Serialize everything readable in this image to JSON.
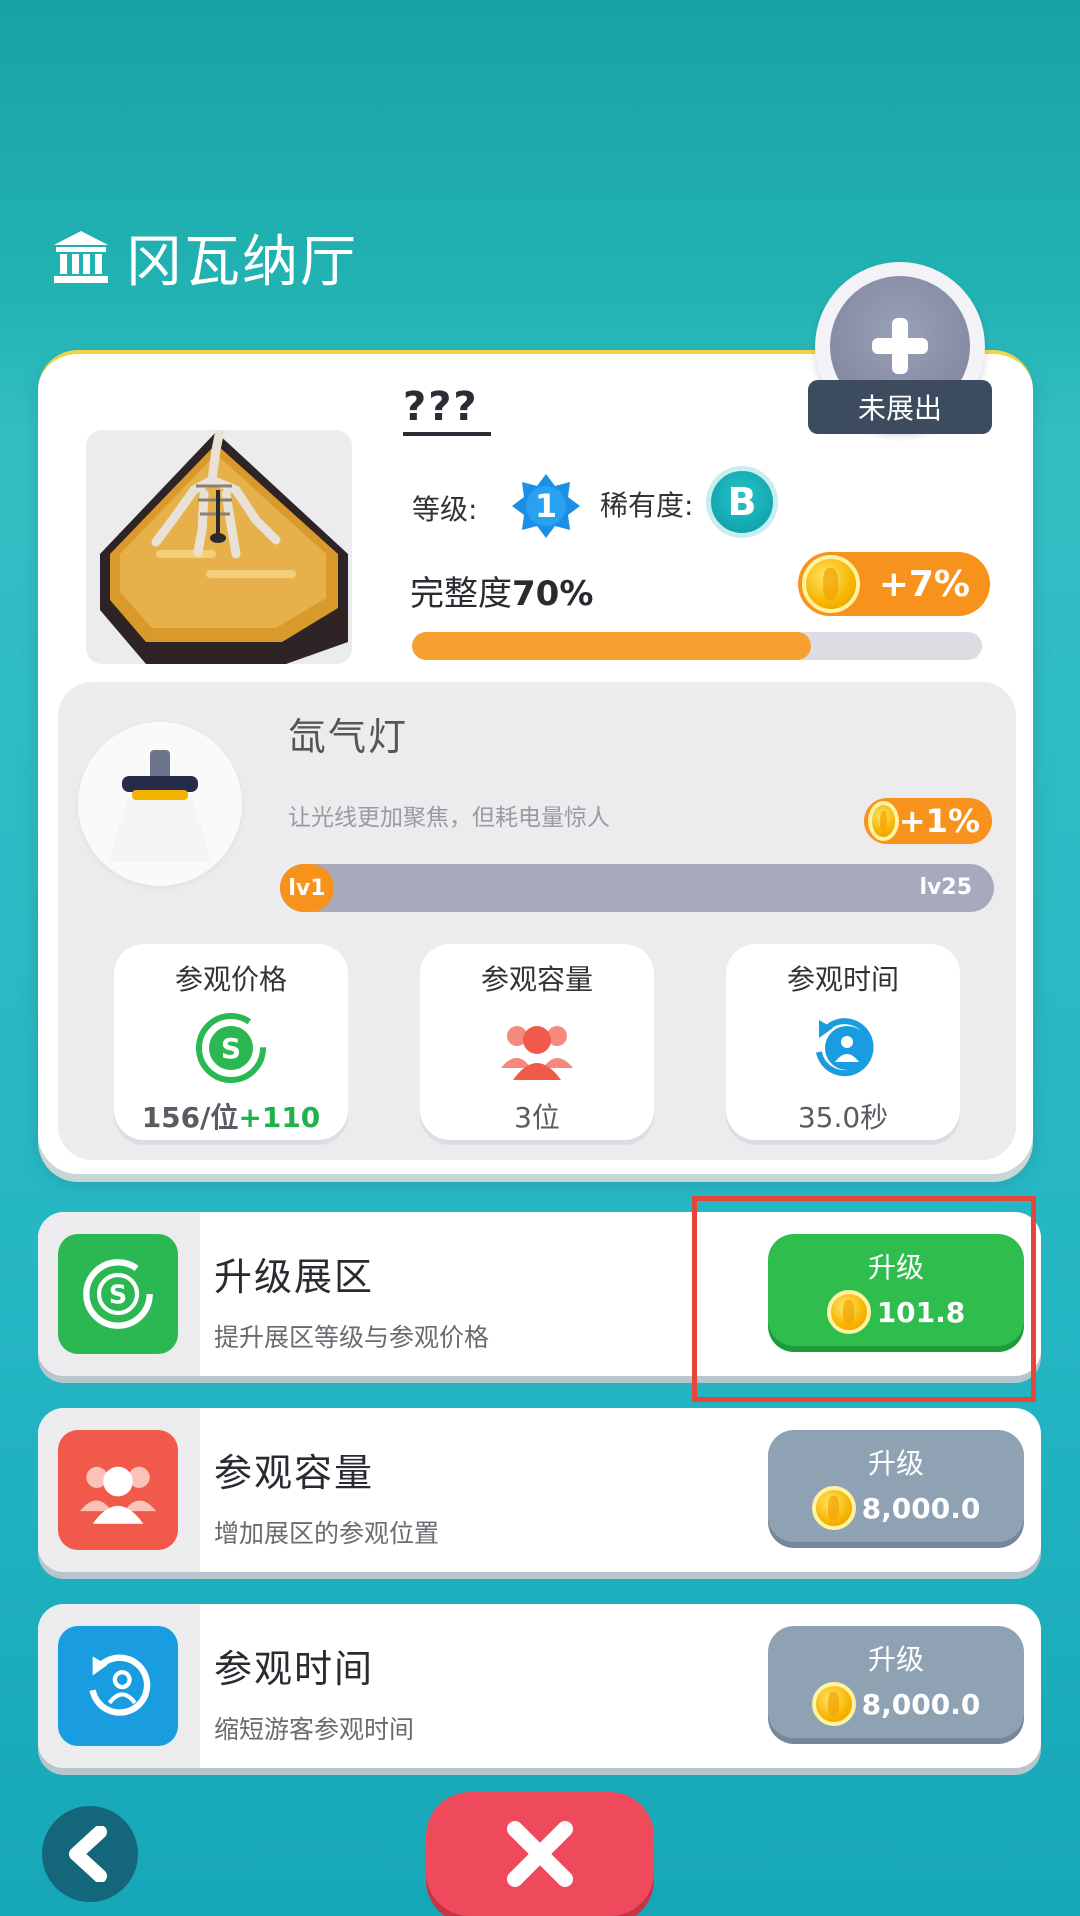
{
  "hall": {
    "title": "冈瓦纳厅"
  },
  "exhibit": {
    "name": "???",
    "level_label": "等级:",
    "level": "1",
    "rarity_label": "稀有度:",
    "rarity": "B",
    "completeness_label": "完整度",
    "completeness_value": "70%",
    "completeness_fraction": 0.7,
    "bonus": "+7%",
    "status": "未展出"
  },
  "equipment": {
    "name": "氙气灯",
    "description": "让光线更加聚焦，但耗电量惊人",
    "bonus": "+1%",
    "level_start": "lv1",
    "level_end": "lv25"
  },
  "stats": [
    {
      "label": "参观价格",
      "value": "156/位",
      "extra": "+110",
      "icon": "dollar-cycle-icon",
      "color": "#2bb852"
    },
    {
      "label": "参观容量",
      "value": "3位",
      "extra": "",
      "icon": "visitors-icon",
      "color": "#f15a4a"
    },
    {
      "label": "参观时间",
      "value": "35.0秒",
      "extra": "",
      "icon": "timer-person-icon",
      "color": "#1a9de0"
    }
  ],
  "upgrades": [
    {
      "title": "升级展区",
      "desc": "提升展区等级与参观价格",
      "button": "升级",
      "cost": "101.8",
      "icon": "dollar-cycle-icon",
      "color": "#2bb852",
      "enabled": true
    },
    {
      "title": "参观容量",
      "desc": "增加展区的参观位置",
      "button": "升级",
      "cost": "8,000.0",
      "icon": "visitors-icon",
      "color": "#f15a4a",
      "enabled": false
    },
    {
      "title": "参观时间",
      "desc": "缩短游客参观时间",
      "button": "升级",
      "cost": "8,000.0",
      "icon": "timer-person-icon",
      "color": "#1a9de0",
      "enabled": false
    }
  ]
}
